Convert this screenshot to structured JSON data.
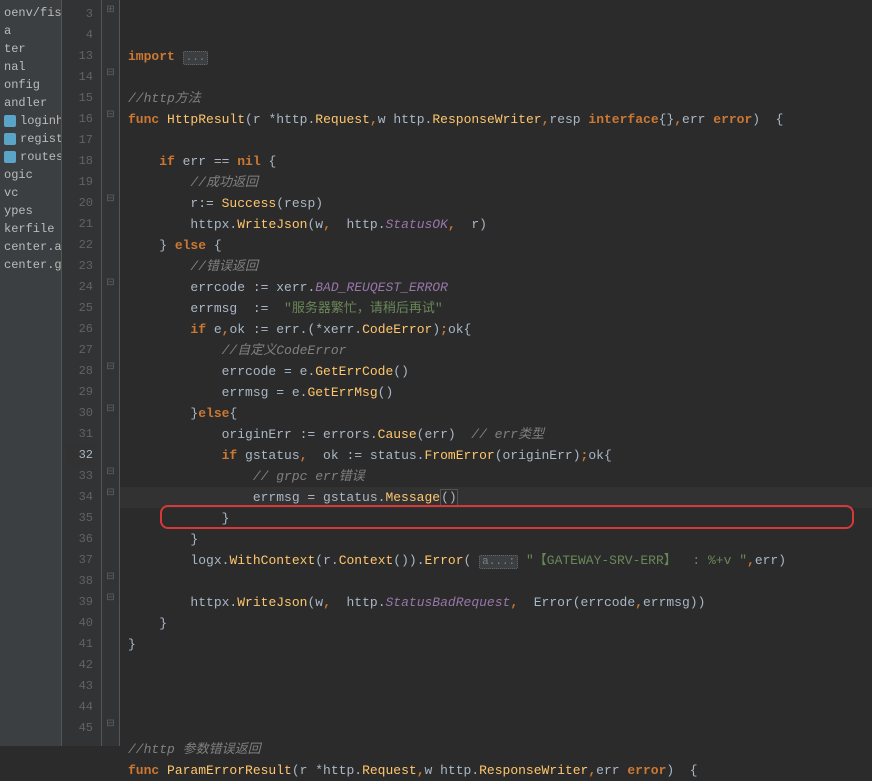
{
  "sidebar": {
    "items": [
      {
        "label": "oenv/fishty"
      },
      {
        "label": "a"
      },
      {
        "label": "ter"
      },
      {
        "label": "nal"
      },
      {
        "label": "onfig"
      },
      {
        "label": "andler"
      },
      {
        "label": "loginhand",
        "icon": "go"
      },
      {
        "label": "registerh",
        "icon": "go"
      },
      {
        "label": "routes.go",
        "icon": "go"
      },
      {
        "label": "ogic"
      },
      {
        "label": "vc"
      },
      {
        "label": "ypes"
      },
      {
        "label": "kerfile"
      },
      {
        "label": "center.api"
      },
      {
        "label": "center.go"
      }
    ]
  },
  "code": {
    "lines": [
      {
        "n": 3,
        "tokens": [
          {
            "t": "import ",
            "c": "kw"
          },
          {
            "t": "...",
            "c": "hint-fold"
          }
        ],
        "fold": "+"
      },
      {
        "n": 4,
        "tokens": []
      },
      {
        "n": 13,
        "tokens": [
          {
            "t": "//http方法",
            "c": "cmt"
          }
        ]
      },
      {
        "n": 14,
        "tokens": [
          {
            "t": "func ",
            "c": "kw"
          },
          {
            "t": "HttpResult",
            "c": "fn"
          },
          {
            "t": "(",
            "c": ""
          },
          {
            "t": "r ",
            "c": ""
          },
          {
            "t": "*",
            "c": ""
          },
          {
            "t": "http",
            "c": "pkg"
          },
          {
            "t": ".",
            "c": ""
          },
          {
            "t": "Request",
            "c": "fn"
          },
          {
            "t": ",",
            "c": "kw"
          },
          {
            "t": "w ",
            "c": ""
          },
          {
            "t": "http",
            "c": "pkg"
          },
          {
            "t": ".",
            "c": ""
          },
          {
            "t": "ResponseWriter",
            "c": "fn"
          },
          {
            "t": ",",
            "c": "kw"
          },
          {
            "t": "resp ",
            "c": ""
          },
          {
            "t": "interface",
            "c": "kw"
          },
          {
            "t": "{}",
            "c": ""
          },
          {
            "t": ",",
            "c": "kw"
          },
          {
            "t": "err ",
            "c": ""
          },
          {
            "t": "error",
            "c": "kw"
          },
          {
            "t": ")  {",
            "c": ""
          }
        ],
        "fold": "-"
      },
      {
        "n": 15,
        "tokens": []
      },
      {
        "n": 16,
        "tokens": [
          {
            "t": "    ",
            "c": ""
          },
          {
            "t": "if ",
            "c": "kw"
          },
          {
            "t": "err ",
            "c": ""
          },
          {
            "t": "== ",
            "c": ""
          },
          {
            "t": "nil ",
            "c": "kw"
          },
          {
            "t": "{",
            "c": ""
          }
        ],
        "fold": "-"
      },
      {
        "n": 17,
        "tokens": [
          {
            "t": "        ",
            "c": ""
          },
          {
            "t": "//成功返回",
            "c": "cmt"
          }
        ]
      },
      {
        "n": 18,
        "tokens": [
          {
            "t": "        r:= ",
            "c": ""
          },
          {
            "t": "Success",
            "c": "fn"
          },
          {
            "t": "(resp)",
            "c": ""
          }
        ]
      },
      {
        "n": 19,
        "tokens": [
          {
            "t": "        httpx",
            "c": ""
          },
          {
            "t": ".",
            "c": ""
          },
          {
            "t": "WriteJson",
            "c": "fn"
          },
          {
            "t": "(w",
            "c": ""
          },
          {
            "t": ", ",
            "c": "kw"
          },
          {
            "t": " http",
            "c": ""
          },
          {
            "t": ".",
            "c": ""
          },
          {
            "t": "StatusOK",
            "c": "const"
          },
          {
            "t": ", ",
            "c": "kw"
          },
          {
            "t": " r)",
            "c": ""
          }
        ]
      },
      {
        "n": 20,
        "tokens": [
          {
            "t": "    } ",
            "c": ""
          },
          {
            "t": "else ",
            "c": "kw"
          },
          {
            "t": "{",
            "c": ""
          }
        ],
        "fold": "-"
      },
      {
        "n": 21,
        "tokens": [
          {
            "t": "        ",
            "c": ""
          },
          {
            "t": "//错误返回",
            "c": "cmt"
          }
        ]
      },
      {
        "n": 22,
        "tokens": [
          {
            "t": "        errcode := xerr",
            "c": ""
          },
          {
            "t": ".",
            "c": ""
          },
          {
            "t": "BAD_REUQEST_ERROR",
            "c": "const"
          }
        ]
      },
      {
        "n": 23,
        "tokens": [
          {
            "t": "        errmsg  :=  ",
            "c": ""
          },
          {
            "t": "\"服务器繁忙，请稍后再试\"",
            "c": "str"
          }
        ]
      },
      {
        "n": 24,
        "tokens": [
          {
            "t": "        ",
            "c": ""
          },
          {
            "t": "if ",
            "c": "kw"
          },
          {
            "t": "e",
            "c": ""
          },
          {
            "t": ",",
            "c": "kw"
          },
          {
            "t": "ok := err.(*xerr",
            "c": ""
          },
          {
            "t": ".",
            "c": ""
          },
          {
            "t": "CodeError",
            "c": "fn"
          },
          {
            "t": ")",
            "c": ""
          },
          {
            "t": ";",
            "c": "kw"
          },
          {
            "t": "ok{",
            "c": ""
          }
        ],
        "fold": "-"
      },
      {
        "n": 25,
        "tokens": [
          {
            "t": "            ",
            "c": ""
          },
          {
            "t": "//自定义CodeError",
            "c": "cmt"
          }
        ]
      },
      {
        "n": 26,
        "tokens": [
          {
            "t": "            errcode = e",
            "c": ""
          },
          {
            "t": ".",
            "c": ""
          },
          {
            "t": "GetErrCode",
            "c": "fn"
          },
          {
            "t": "()",
            "c": ""
          }
        ]
      },
      {
        "n": 27,
        "tokens": [
          {
            "t": "            errmsg = e",
            "c": ""
          },
          {
            "t": ".",
            "c": ""
          },
          {
            "t": "GetErrMsg",
            "c": "fn"
          },
          {
            "t": "()",
            "c": ""
          }
        ]
      },
      {
        "n": 28,
        "tokens": [
          {
            "t": "        }",
            "c": ""
          },
          {
            "t": "else",
            "c": "kw"
          },
          {
            "t": "{",
            "c": ""
          }
        ],
        "fold": "-"
      },
      {
        "n": 29,
        "tokens": [
          {
            "t": "            originErr := errors",
            "c": ""
          },
          {
            "t": ".",
            "c": ""
          },
          {
            "t": "Cause",
            "c": "fn"
          },
          {
            "t": "(err)  ",
            "c": ""
          },
          {
            "t": "// err类型",
            "c": "cmt"
          }
        ]
      },
      {
        "n": 30,
        "tokens": [
          {
            "t": "            ",
            "c": ""
          },
          {
            "t": "if ",
            "c": "kw"
          },
          {
            "t": "gstatus",
            "c": ""
          },
          {
            "t": ", ",
            "c": "kw"
          },
          {
            "t": " ok := status",
            "c": ""
          },
          {
            "t": ".",
            "c": ""
          },
          {
            "t": "FromError",
            "c": "fn"
          },
          {
            "t": "(originErr)",
            "c": ""
          },
          {
            "t": ";",
            "c": "kw"
          },
          {
            "t": "ok{",
            "c": ""
          }
        ],
        "fold": "-"
      },
      {
        "n": 31,
        "tokens": [
          {
            "t": "                ",
            "c": ""
          },
          {
            "t": "// grpc err错误",
            "c": "cmt"
          }
        ]
      },
      {
        "n": 32,
        "tokens": [
          {
            "t": "                errmsg = gstatus",
            "c": ""
          },
          {
            "t": ".",
            "c": ""
          },
          {
            "t": "Message",
            "c": "fn"
          },
          {
            "t": "()",
            "c": "caret-box"
          }
        ],
        "active": true
      },
      {
        "n": 33,
        "tokens": [
          {
            "t": "            }",
            "c": ""
          }
        ],
        "fold": "-"
      },
      {
        "n": 34,
        "tokens": [
          {
            "t": "        }",
            "c": ""
          }
        ],
        "fold": "-"
      },
      {
        "n": 35,
        "tokens": [
          {
            "t": "        logx",
            "c": ""
          },
          {
            "t": ".",
            "c": ""
          },
          {
            "t": "WithContext",
            "c": "fn"
          },
          {
            "t": "(r",
            "c": ""
          },
          {
            "t": ".",
            "c": ""
          },
          {
            "t": "Context",
            "c": "fn"
          },
          {
            "t": "())",
            "c": ""
          },
          {
            "t": ".",
            "c": ""
          },
          {
            "t": "Error",
            "c": "fn"
          },
          {
            "t": "( ",
            "c": ""
          },
          {
            "t": "a...:",
            "c": "hint-fold"
          },
          {
            "t": " ",
            "c": ""
          },
          {
            "t": "\"【GATEWAY-SRV-ERR】  : %+v \"",
            "c": "str"
          },
          {
            "t": ",",
            "c": "kw"
          },
          {
            "t": "err)",
            "c": ""
          }
        ]
      },
      {
        "n": 36,
        "tokens": []
      },
      {
        "n": 37,
        "tokens": [
          {
            "t": "        httpx",
            "c": ""
          },
          {
            "t": ".",
            "c": ""
          },
          {
            "t": "WriteJson",
            "c": "fn"
          },
          {
            "t": "(w",
            "c": ""
          },
          {
            "t": ", ",
            "c": "kw"
          },
          {
            "t": " http",
            "c": ""
          },
          {
            "t": ".",
            "c": ""
          },
          {
            "t": "StatusBadRequest",
            "c": "const"
          },
          {
            "t": ", ",
            "c": "kw"
          },
          {
            "t": " Error(errcode",
            "c": ""
          },
          {
            "t": ",",
            "c": "kw"
          },
          {
            "t": "errmsg))",
            "c": ""
          }
        ]
      },
      {
        "n": 38,
        "tokens": [
          {
            "t": "    }",
            "c": ""
          }
        ],
        "fold": "-"
      },
      {
        "n": 39,
        "tokens": [
          {
            "t": "}",
            "c": ""
          }
        ],
        "fold": "-"
      },
      {
        "n": 40,
        "tokens": []
      },
      {
        "n": 41,
        "tokens": []
      },
      {
        "n": 42,
        "tokens": []
      },
      {
        "n": 43,
        "tokens": []
      },
      {
        "n": 44,
        "tokens": [
          {
            "t": "//http 参数错误返回",
            "c": "cmt"
          }
        ]
      },
      {
        "n": 45,
        "tokens": [
          {
            "t": "func ",
            "c": "kw"
          },
          {
            "t": "ParamErrorResult",
            "c": "fn"
          },
          {
            "t": "(r *http",
            "c": ""
          },
          {
            "t": ".",
            "c": ""
          },
          {
            "t": "Request",
            "c": "fn"
          },
          {
            "t": ",",
            "c": "kw"
          },
          {
            "t": "w http",
            "c": ""
          },
          {
            "t": ".",
            "c": ""
          },
          {
            "t": "ResponseWriter",
            "c": "fn"
          },
          {
            "t": ",",
            "c": "kw"
          },
          {
            "t": "err ",
            "c": ""
          },
          {
            "t": "error",
            "c": "kw"
          },
          {
            "t": ")  {",
            "c": ""
          }
        ],
        "fold": "-"
      }
    ]
  }
}
